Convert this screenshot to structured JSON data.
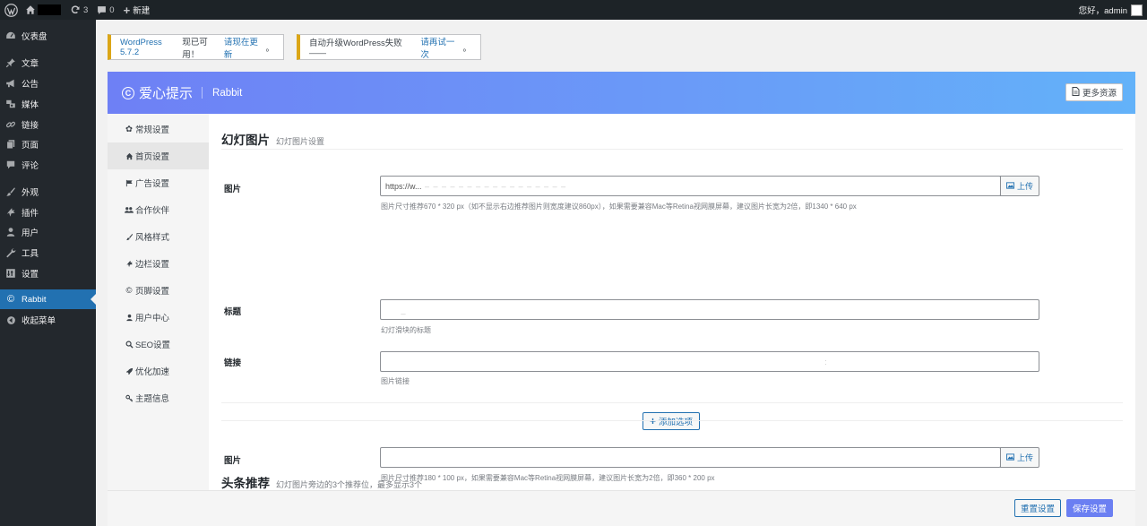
{
  "adminbar": {
    "updates_count": "3",
    "comments_count": "0",
    "new_label": "新建",
    "greeting": "您好，admin"
  },
  "sidebar": {
    "items": [
      {
        "label": "仪表盘",
        "icon": "dashboard-icon"
      },
      {
        "label": "文章",
        "icon": "pin-icon"
      },
      {
        "label": "公告",
        "icon": "megaphone-icon"
      },
      {
        "label": "媒体",
        "icon": "media-icon"
      },
      {
        "label": "链接",
        "icon": "link-icon"
      },
      {
        "label": "页面",
        "icon": "page-icon"
      },
      {
        "label": "评论",
        "icon": "comment-icon"
      },
      {
        "label": "外观",
        "icon": "brush-icon"
      },
      {
        "label": "插件",
        "icon": "plugin-icon"
      },
      {
        "label": "用户",
        "icon": "user-icon"
      },
      {
        "label": "工具",
        "icon": "wrench-icon"
      },
      {
        "label": "设置",
        "icon": "settings-icon"
      },
      {
        "label": "Rabbit",
        "icon": "copyright-icon"
      },
      {
        "label": "收起菜单",
        "icon": "collapse-icon"
      }
    ]
  },
  "notices": {
    "update_prefix": "WordPress 5.7.2",
    "update_middle": "现已可用！",
    "update_link": "请现在更新",
    "update_suffix": "。",
    "fail_text": "自动升级WordPress失败 —— ",
    "fail_link": "请再试一次",
    "fail_suffix": "。"
  },
  "header": {
    "brand": "爱心提示",
    "sub": "Rabbit",
    "more_button": "更多资源"
  },
  "subnav": {
    "items": [
      {
        "label": "常规设置",
        "icon": "gear-icon"
      },
      {
        "label": "首页设置",
        "icon": "home-icon"
      },
      {
        "label": "广告设置",
        "icon": "flag-icon"
      },
      {
        "label": "合作伙伴",
        "icon": "group-icon"
      },
      {
        "label": "风格样式",
        "icon": "brush-icon"
      },
      {
        "label": "边栏设置",
        "icon": "plugin-icon"
      },
      {
        "label": "页脚设置",
        "icon": "copyright-icon"
      },
      {
        "label": "用户中心",
        "icon": "user-icon"
      },
      {
        "label": "SEO设置",
        "icon": "search-icon"
      },
      {
        "label": "优化加速",
        "icon": "rocket-icon"
      },
      {
        "label": "主题信息",
        "icon": "key-icon"
      }
    ]
  },
  "slides": {
    "title": "幻灯图片",
    "desc": "幻灯图片设置",
    "image_label": "图片",
    "image_value": "https://w...",
    "upload_label": "上传",
    "image_help": "图片尺寸推荐670 * 320 px（如不显示右边推荐图片则宽度建议860px），如果需要兼容Mac等Retina视网膜屏幕，建议图片长宽为2倍，即1340 * 640 px",
    "title_label": "标题",
    "title_help": "幻灯滑块的标题",
    "link_label": "链接",
    "link_help": "图片链接",
    "add_button": "添加选项"
  },
  "headlines": {
    "title": "头条推荐",
    "desc": "幻灯图片旁边的3个推荐位，最多显示3个",
    "image_label": "图片",
    "upload_label": "上传",
    "image_help": "图片尺寸推荐180 * 100 px，如果需要兼容Mac等Retina视网膜屏幕，建议图片长宽为2倍，即360 * 200 px"
  },
  "footer": {
    "reset_button": "重置设置",
    "save_button": "保存设置"
  },
  "colors": {
    "accent": "#2271b1",
    "header_gradient_start": "#6e80f5",
    "header_gradient_end": "#63b2f9",
    "save_button": "#6b7ff2"
  }
}
